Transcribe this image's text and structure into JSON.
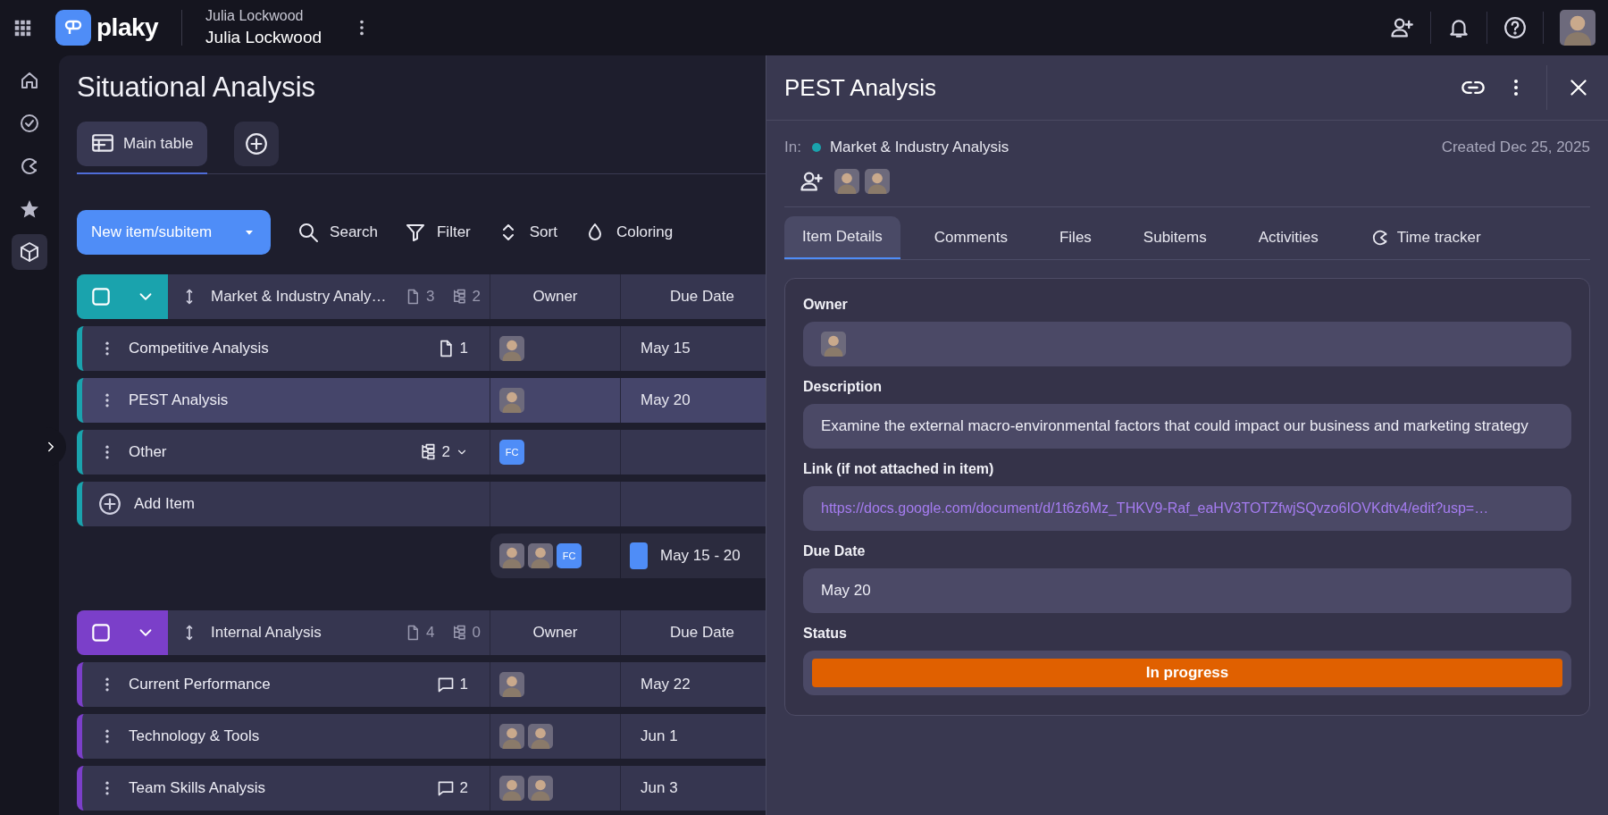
{
  "topbar": {
    "logo_text": "plaky",
    "workspace_owner": "Julia Lockwood",
    "workspace_name": "Julia Lockwood"
  },
  "sidebar": {
    "items": [
      {
        "kind": "home",
        "selected": false
      },
      {
        "kind": "tasks",
        "selected": false
      },
      {
        "kind": "time",
        "selected": false
      },
      {
        "kind": "favorites",
        "selected": false
      },
      {
        "kind": "boards",
        "selected": true
      }
    ]
  },
  "board": {
    "title": "Situational Analysis",
    "views": [
      {
        "label": "Main table",
        "selected": true
      }
    ],
    "toolbar": {
      "new_button": "New item/subitem",
      "actions": [
        {
          "kind": "search",
          "label": "Search"
        },
        {
          "kind": "filter",
          "label": "Filter"
        },
        {
          "kind": "sort",
          "label": "Sort"
        },
        {
          "kind": "coloring",
          "label": "Coloring"
        }
      ]
    },
    "groups": [
      {
        "title": "Market & Industry Analy…",
        "color": "#1aa3ad",
        "checked": false,
        "items_count": "3",
        "subitems_count": "2",
        "columns": [
          "Owner",
          "Due Date"
        ],
        "rows": [
          {
            "name": "Competitive Analysis",
            "selected": false,
            "meta": {
              "kind": "files",
              "count": "1"
            },
            "owners": [
              {
                "kind": "photo"
              }
            ],
            "due": "May 15"
          },
          {
            "name": "PEST Analysis",
            "selected": true,
            "owners": [
              {
                "kind": "photo"
              }
            ],
            "due": "May 20"
          },
          {
            "name": "Other",
            "selected": false,
            "meta": {
              "kind": "subitems",
              "count": "2",
              "caret": true
            },
            "owners": [
              {
                "kind": "initials",
                "text": "FC"
              }
            ]
          }
        ],
        "add_item": "Add Item",
        "summary": {
          "owners": [
            {
              "kind": "photo"
            },
            {
              "kind": "photo"
            },
            {
              "kind": "initials",
              "text": "FC"
            }
          ],
          "date_range": {
            "text": "May 15 - 20",
            "color": "#4f8df7"
          }
        }
      },
      {
        "title": "Internal Analysis",
        "color": "#7b3fc9",
        "checked": false,
        "items_count": "4",
        "subitems_count": "0",
        "columns": [
          "Owner",
          "Due Date"
        ],
        "rows": [
          {
            "name": "Current Performance",
            "selected": false,
            "meta": {
              "kind": "comments",
              "count": "1"
            },
            "owners": [
              {
                "kind": "photo"
              }
            ],
            "due": "May 22"
          },
          {
            "name": "Technology & Tools",
            "selected": false,
            "owners": [
              {
                "kind": "photo"
              },
              {
                "kind": "photo"
              }
            ],
            "due": "Jun 1"
          },
          {
            "name": "Team Skills Analysis",
            "selected": false,
            "meta": {
              "kind": "comments",
              "count": "2"
            },
            "owners": [
              {
                "kind": "photo"
              },
              {
                "kind": "photo"
              }
            ],
            "due": "Jun 3"
          }
        ]
      }
    ]
  },
  "panel": {
    "title": "PEST Analysis",
    "in_label": "In:",
    "group": {
      "name": "Market & Industry Analysis",
      "color": "#1aa3ad"
    },
    "created": "Created Dec 25, 2025",
    "watchers": [
      {
        "kind": "photo"
      },
      {
        "kind": "photo"
      }
    ],
    "tabs": [
      {
        "label": "Item Details",
        "selected": true,
        "kind": "plain"
      },
      {
        "label": "Comments",
        "selected": false,
        "kind": "plain"
      },
      {
        "label": "Files",
        "selected": false,
        "kind": "plain"
      },
      {
        "label": "Subitems",
        "selected": false,
        "kind": "plain"
      },
      {
        "label": "Activities",
        "selected": false,
        "kind": "plain"
      },
      {
        "label": "Time tracker",
        "selected": false,
        "kind": "timer"
      }
    ],
    "fields": [
      {
        "kind": "people",
        "label": "Owner",
        "owners": [
          {
            "kind": "photo"
          }
        ]
      },
      {
        "kind": "text",
        "label": "Description",
        "value": "Examine the external macro-environmental factors that could impact our business and marketing strategy"
      },
      {
        "kind": "link",
        "label": "Link (if not attached in item)",
        "value": "https://docs.google.com/document/d/1t6z6Mz_THKV9-Raf_eaHV3TOTZfwjSQvzo6IOVKdtv4/edit?usp=…"
      },
      {
        "kind": "text",
        "label": "Due Date",
        "value": "May 20"
      },
      {
        "kind": "status",
        "label": "Status",
        "value": "In progress",
        "color": "#e06000"
      }
    ]
  }
}
